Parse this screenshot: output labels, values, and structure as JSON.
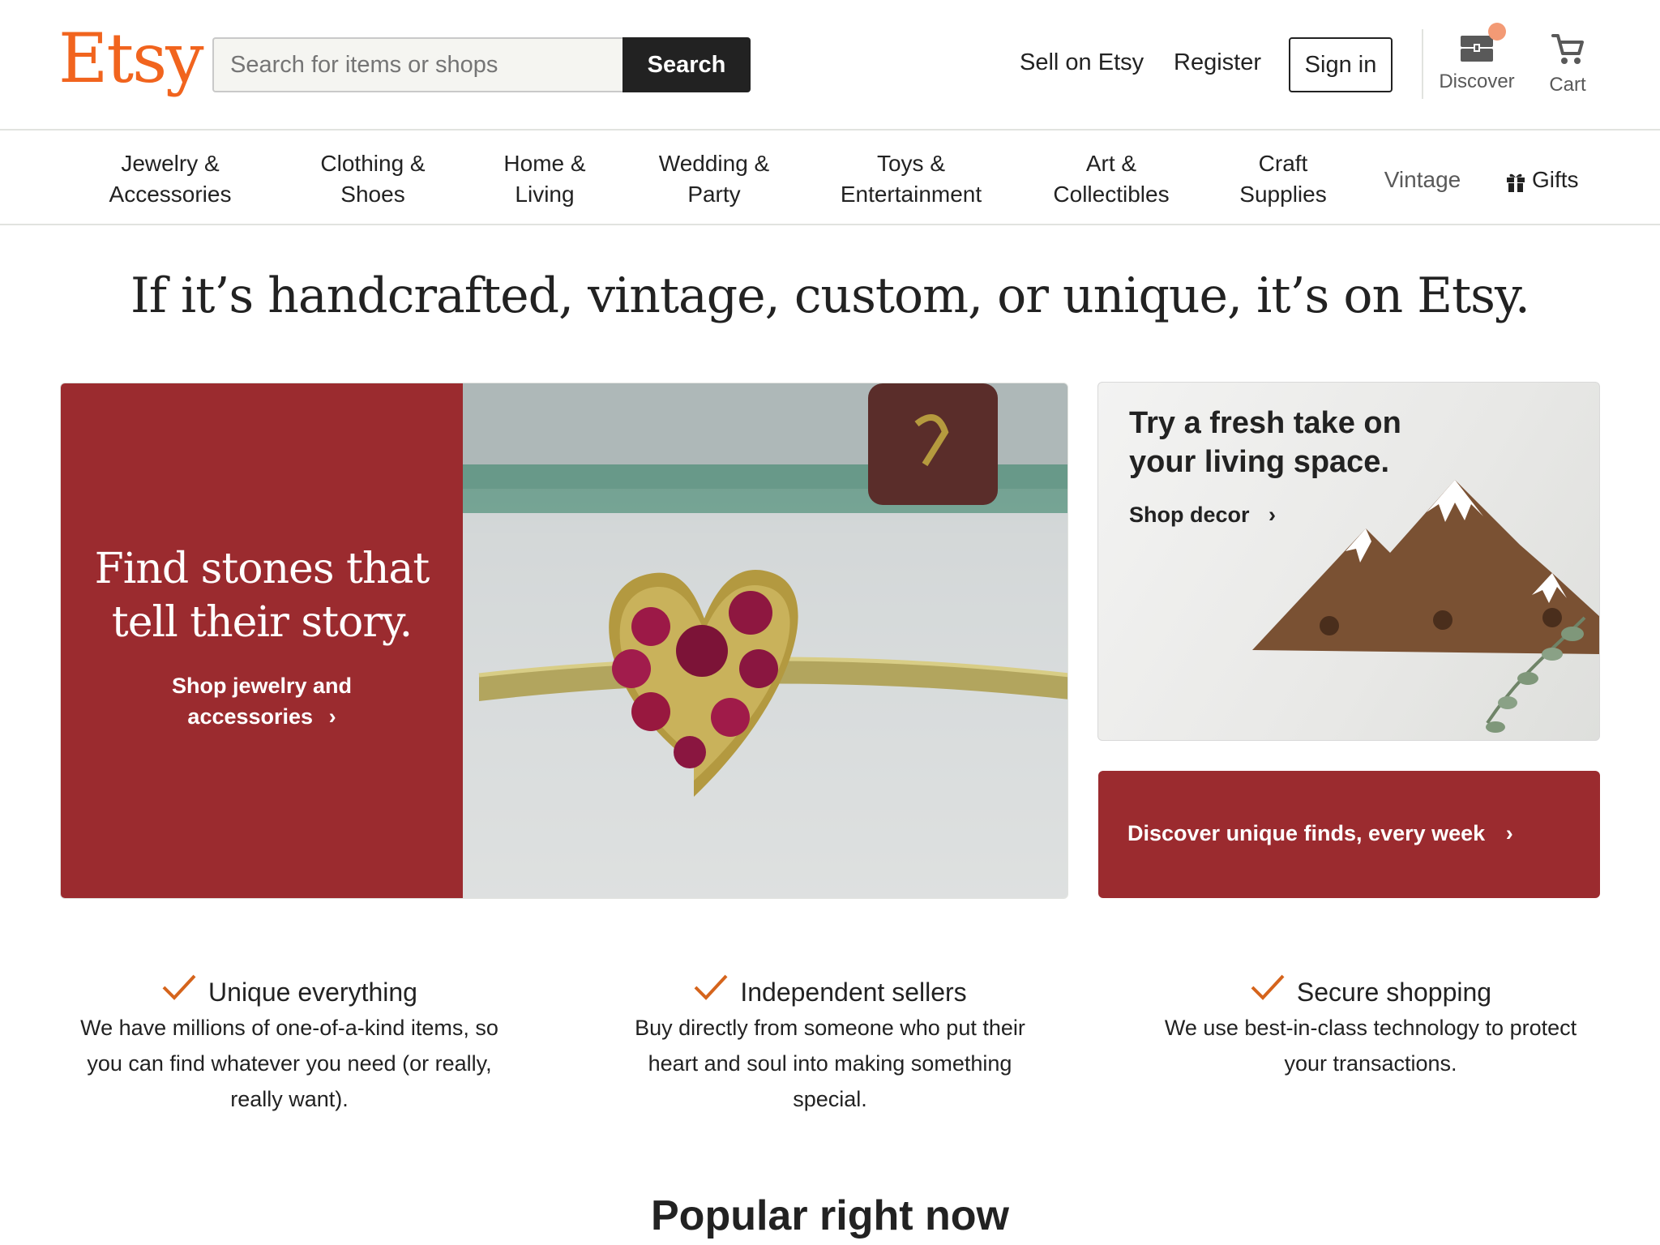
{
  "header": {
    "logo": "Etsy",
    "search": {
      "placeholder": "Search for items or shops",
      "value": "",
      "button_label": "Search"
    },
    "links": {
      "sell": "Sell on Etsy",
      "register": "Register",
      "sign_in": "Sign in"
    },
    "discover_label": "Discover",
    "cart_label": "Cart"
  },
  "categories": [
    {
      "line1": "Jewelry &",
      "line2": "Accessories"
    },
    {
      "line1": "Clothing &",
      "line2": "Shoes"
    },
    {
      "line1": "Home &",
      "line2": "Living"
    },
    {
      "line1": "Wedding &",
      "line2": "Party"
    },
    {
      "line1": "Toys &",
      "line2": "Entertainment"
    },
    {
      "line1": "Art &",
      "line2": "Collectibles"
    },
    {
      "line1": "Craft",
      "line2": "Supplies"
    },
    {
      "line1": "Vintage",
      "line2": ""
    },
    {
      "line1": "Gifts",
      "line2": ""
    }
  ],
  "tagline": "If it’s handcrafted, vintage, custom, or unique, it’s on Etsy.",
  "hero": {
    "title_line1": "Find stones that",
    "title_line2": "tell their story.",
    "cta_line1": "Shop jewelry and",
    "cta_line2": "accessories"
  },
  "decor": {
    "title_line1": "Try a fresh take on",
    "title_line2": "your living space.",
    "cta": "Shop decor"
  },
  "discover": {
    "cta": "Discover unique finds, every week"
  },
  "value_props": [
    {
      "title": "Unique everything",
      "lines": [
        "We have millions of one-of-a-kind items, so",
        "you can find whatever you need (or really,",
        "really want)."
      ]
    },
    {
      "title": "Independent sellers",
      "lines": [
        "Buy directly from someone who put their",
        "heart and soul into making something",
        "special."
      ]
    },
    {
      "title": "Secure shopping",
      "lines": [
        "We use best-in-class technology to protect",
        "your transactions."
      ]
    }
  ],
  "popular_heading": "Popular right now",
  "colors": {
    "brand_orange": "#f1641e",
    "hero_red": "#9b2b2f",
    "check_orange": "#d5641c"
  },
  "icons": [
    "discover-chest-icon",
    "cart-icon",
    "gift-icon",
    "chevron-right-icon",
    "checkmark-icon"
  ]
}
